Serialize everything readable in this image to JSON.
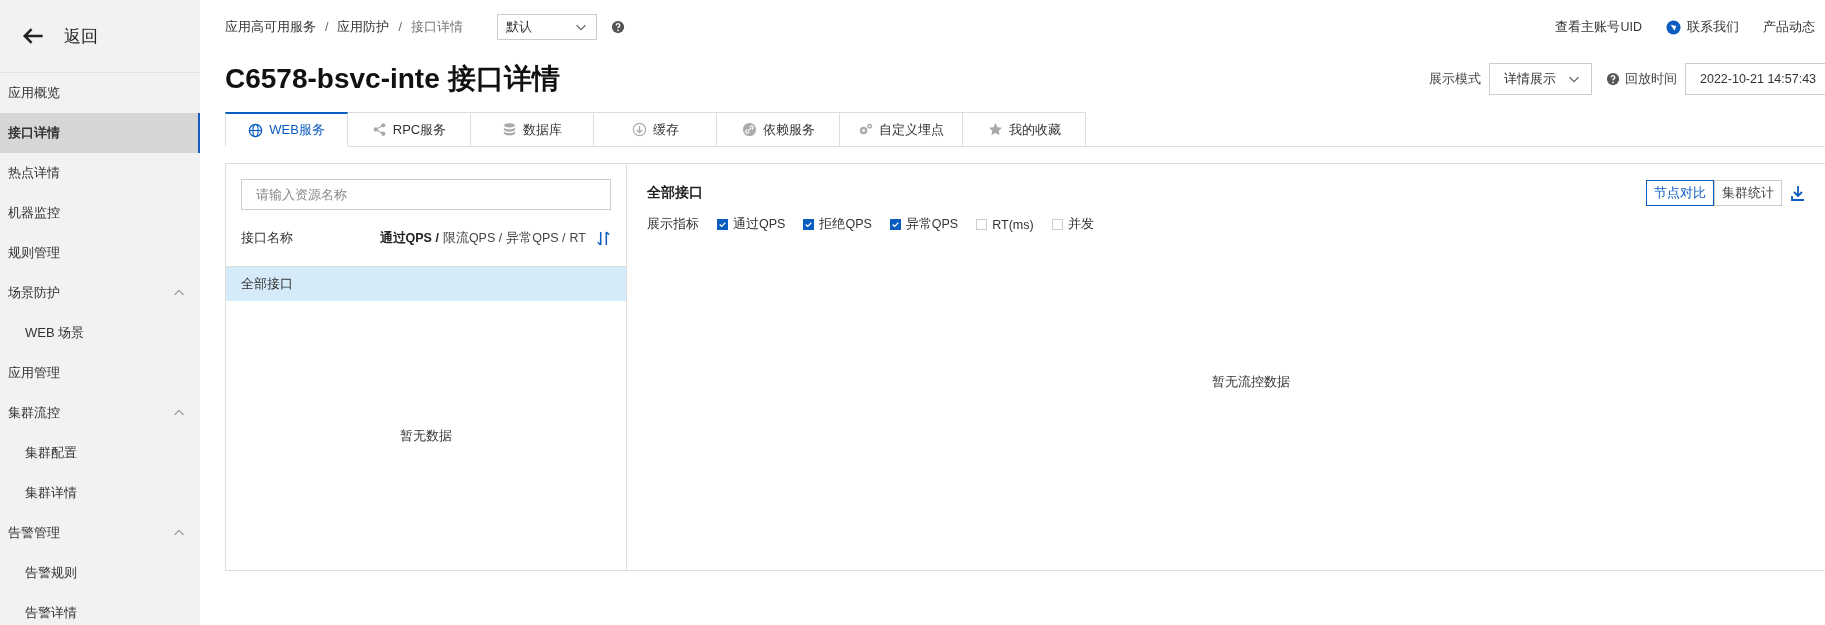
{
  "sidebar": {
    "back_label": "返回",
    "items": [
      {
        "label": "应用概览",
        "selected": false
      },
      {
        "label": "接口详情",
        "selected": true
      },
      {
        "label": "热点详情",
        "selected": false
      },
      {
        "label": "机器监控",
        "selected": false
      },
      {
        "label": "规则管理",
        "selected": false
      },
      {
        "label": "场景防护",
        "selected": false,
        "expanded": true,
        "children": [
          {
            "label": "WEB 场景",
            "selected": false
          }
        ]
      },
      {
        "label": "应用管理",
        "selected": false
      },
      {
        "label": "集群流控",
        "selected": false,
        "expanded": true,
        "children": [
          {
            "label": "集群配置",
            "selected": false
          },
          {
            "label": "集群详情",
            "selected": false
          }
        ]
      },
      {
        "label": "告警管理",
        "selected": false,
        "expanded": true,
        "children": [
          {
            "label": "告警规则",
            "selected": false
          },
          {
            "label": "告警详情",
            "selected": false
          }
        ]
      }
    ]
  },
  "header": {
    "breadcrumb": [
      "应用高可用服务",
      "应用防护",
      "接口详情"
    ],
    "breadcrumb_separator": "/",
    "namespace_select": "默认",
    "top_links": [
      "查看主账号UID",
      "联系我们",
      "产品动态"
    ]
  },
  "title": "C6578-bsvc-inte 接口详情",
  "display_mode": {
    "label": "展示模式",
    "value": "详情展示"
  },
  "playback": {
    "label": "回放时间",
    "value": "2022-10-21 14:57:43"
  },
  "tabs": [
    {
      "label": "WEB服务",
      "selected": true
    },
    {
      "label": "RPC服务",
      "selected": false
    },
    {
      "label": "数据库",
      "selected": false
    },
    {
      "label": "缓存",
      "selected": false
    },
    {
      "label": "依赖服务",
      "selected": false
    },
    {
      "label": "自定义埋点",
      "selected": false
    },
    {
      "label": "我的收藏",
      "selected": false
    }
  ],
  "resource_list": {
    "search": {
      "placeholder": "请输入资源名称"
    },
    "column": "接口名称",
    "sort_metrics": [
      {
        "label": "通过QPS /",
        "selected": true
      },
      {
        "label": "限流QPS /",
        "selected": false
      },
      {
        "label": "异常QPS /",
        "selected": false
      },
      {
        "label": "RT",
        "selected": false
      }
    ],
    "rows": [
      {
        "label": "全部接口",
        "selected": true
      }
    ],
    "empty_text": "暂无数据"
  },
  "detail": {
    "title": "全部接口",
    "view_toggle": [
      {
        "label": "节点对比",
        "selected": true
      },
      {
        "label": "集群统计",
        "selected": false
      }
    ],
    "metrics_label": "展示指标",
    "metrics": [
      {
        "label": "通过QPS",
        "checked": true
      },
      {
        "label": "拒绝QPS",
        "checked": true
      },
      {
        "label": "异常QPS",
        "checked": true
      },
      {
        "label": "RT(ms)",
        "checked": false
      },
      {
        "label": "并发",
        "checked": false
      }
    ],
    "empty_text": "暂无流控数据"
  }
}
